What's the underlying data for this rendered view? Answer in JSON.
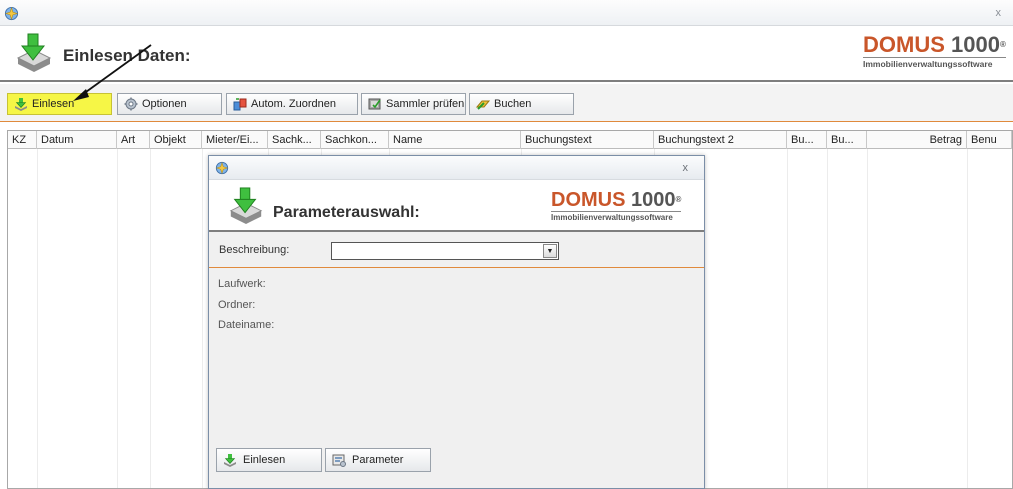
{
  "window": {
    "close_label": "x",
    "header_title": "Einlesen Daten:"
  },
  "logo": {
    "brand": "DOMUS",
    "number": "1000",
    "registered": "®",
    "tagline": "Immobilienverwaltungssoftware"
  },
  "toolbar": {
    "buttons": [
      {
        "label": "Einlesen",
        "icon": "import-green-arrow-icon",
        "active": true
      },
      {
        "label": "Optionen",
        "icon": "gear-icon"
      },
      {
        "label": "Autom. Zuordnen",
        "icon": "auto-assign-icon"
      },
      {
        "label": "Sammler prüfen",
        "icon": "check-collection-icon"
      },
      {
        "label": "Buchen",
        "icon": "booking-icon"
      }
    ]
  },
  "grid": {
    "columns": [
      "KZ",
      "Datum",
      "Art",
      "Objekt",
      "Mieter/Ei...",
      "Sachk...",
      "Sachkon...",
      "Name",
      "Buchungstext",
      "Buchungstext 2",
      "Bu...",
      "Bu...",
      "Betrag",
      "Benu"
    ]
  },
  "dialog": {
    "close_label": "x",
    "title": "Parameterauswahl:",
    "beschreibung_label": "Beschreibung:",
    "beschreibung_value": "",
    "laufwerk_label": "Laufwerk:",
    "ordner_label": "Ordner:",
    "dateiname_label": "Dateiname:",
    "buttons": [
      {
        "label": "Einlesen",
        "icon": "import-green-arrow-icon"
      },
      {
        "label": "Parameter",
        "icon": "parameter-icon"
      }
    ]
  },
  "colors": {
    "accent_orange": "#e08a3c",
    "brand_orange": "#c9562a",
    "active_button": "#f6f646"
  }
}
